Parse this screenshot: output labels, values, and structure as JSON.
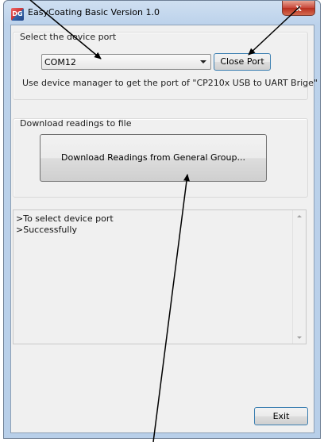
{
  "window": {
    "title": "EasyCoating Basic Version 1.0",
    "icon": "app-logo-icon",
    "icon_text": "DG",
    "close_glyph": "x"
  },
  "port_group": {
    "label": "Select the device port",
    "combo_value": "COM12",
    "close_port_label": "Close Port",
    "hint": "Use device manager to get the port of \"CP210x USB to UART Brige\""
  },
  "download_group": {
    "label": "Download readings to file",
    "button_label": "Download Readings from General Group..."
  },
  "log": {
    "lines": [
      ">To select device port",
      ">Successfully"
    ]
  },
  "footer": {
    "exit_label": "Exit"
  },
  "colors": {
    "annotation_arrow": "#000000",
    "window_frame": "#bcd2eb",
    "client_bg": "#f0f0f0"
  }
}
